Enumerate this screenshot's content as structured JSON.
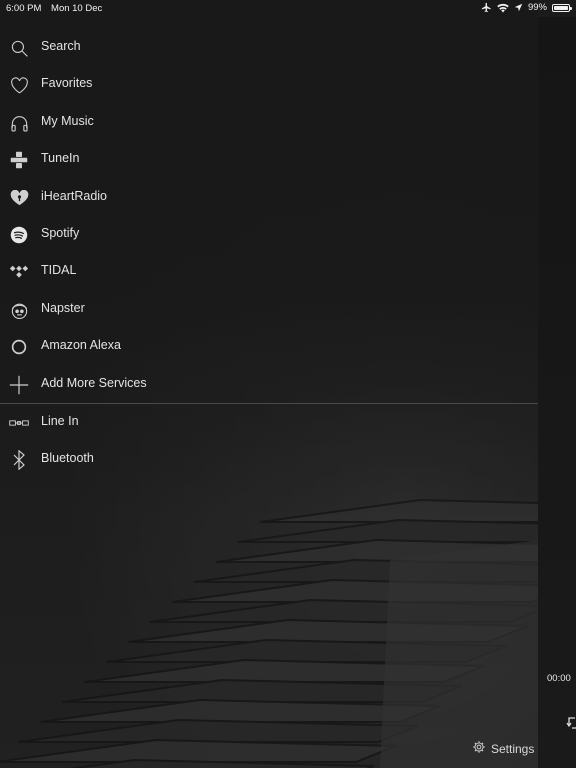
{
  "status_bar": {
    "time": "6:00 PM",
    "date": "Mon 10 Dec",
    "battery": "99%",
    "battery_level": 0.99
  },
  "menu": {
    "items": [
      {
        "label": "Search",
        "icon": "search-icon"
      },
      {
        "label": "Favorites",
        "icon": "heart-icon"
      },
      {
        "label": "My Music",
        "icon": "headphones-icon"
      },
      {
        "label": "TuneIn",
        "icon": "tunein-icon"
      },
      {
        "label": "iHeartRadio",
        "icon": "iheartradio-icon"
      },
      {
        "label": "Spotify",
        "icon": "spotify-icon"
      },
      {
        "label": "TIDAL",
        "icon": "tidal-icon"
      },
      {
        "label": "Napster",
        "icon": "napster-icon"
      },
      {
        "label": "Amazon Alexa",
        "icon": "alexa-icon"
      },
      {
        "label": "Add More Services",
        "icon": "plus-icon"
      }
    ],
    "inputs": [
      {
        "label": "Line In",
        "icon": "line-in-icon"
      },
      {
        "label": "Bluetooth",
        "icon": "bluetooth-icon"
      }
    ]
  },
  "settings": {
    "label": "Settings",
    "icon": "gear-icon"
  },
  "player": {
    "elapsed": "00:00"
  },
  "colors": {
    "background": "#1a1a1a",
    "text": "#e4e4e4",
    "divider": "#4a4a4a"
  }
}
